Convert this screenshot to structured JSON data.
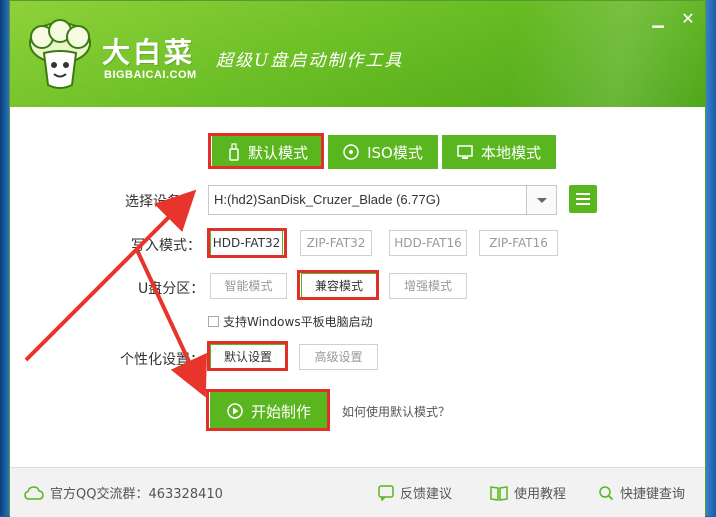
{
  "app": {
    "brand_name": "大白菜",
    "brand_url": "BIGBAICAI.COM",
    "slogan": "超级U盘启动制作工具",
    "minimize_glyph": "▁",
    "close_glyph": "✕"
  },
  "modes": {
    "default_label": "默认模式",
    "iso_label": "ISO模式",
    "local_label": "本地模式",
    "active": "default"
  },
  "device": {
    "label": "选择设备：",
    "value": "H:(hd2)SanDisk_Cruzer_Blade (6.77G)"
  },
  "write_mode": {
    "label": "写入模式：",
    "options": [
      "HDD-FAT32",
      "ZIP-FAT32",
      "HDD-FAT16",
      "ZIP-FAT16"
    ],
    "selected": "HDD-FAT32"
  },
  "partition": {
    "label": "U盘分区：",
    "options": [
      "智能模式",
      "兼容模式",
      "增强模式"
    ],
    "selected": "兼容模式",
    "windows_tablet_checkbox": "支持Windows平板电脑启动",
    "windows_tablet_checked": false
  },
  "personalize": {
    "label": "个性化设置：",
    "options": [
      "默认设置",
      "高级设置"
    ],
    "selected": "默认设置"
  },
  "actions": {
    "start_label": "开始制作",
    "help_link": "如何使用默认模式？"
  },
  "footer": {
    "qq_group": "官方QQ交流群：463328410",
    "feedback": "反馈建议",
    "tutorial": "使用教程",
    "shortcut_query": "快捷键查询"
  },
  "colors": {
    "brand_green": "#5ab61e",
    "highlight_red": "#e0302a"
  },
  "icons": {
    "usb": "usb-icon",
    "disc": "disc-icon",
    "monitor": "monitor-icon",
    "menu": "menu-icon",
    "play": "play-icon",
    "cloud": "cloud-icon",
    "feedback": "feedback-icon",
    "book": "book-icon",
    "search": "search-icon"
  }
}
